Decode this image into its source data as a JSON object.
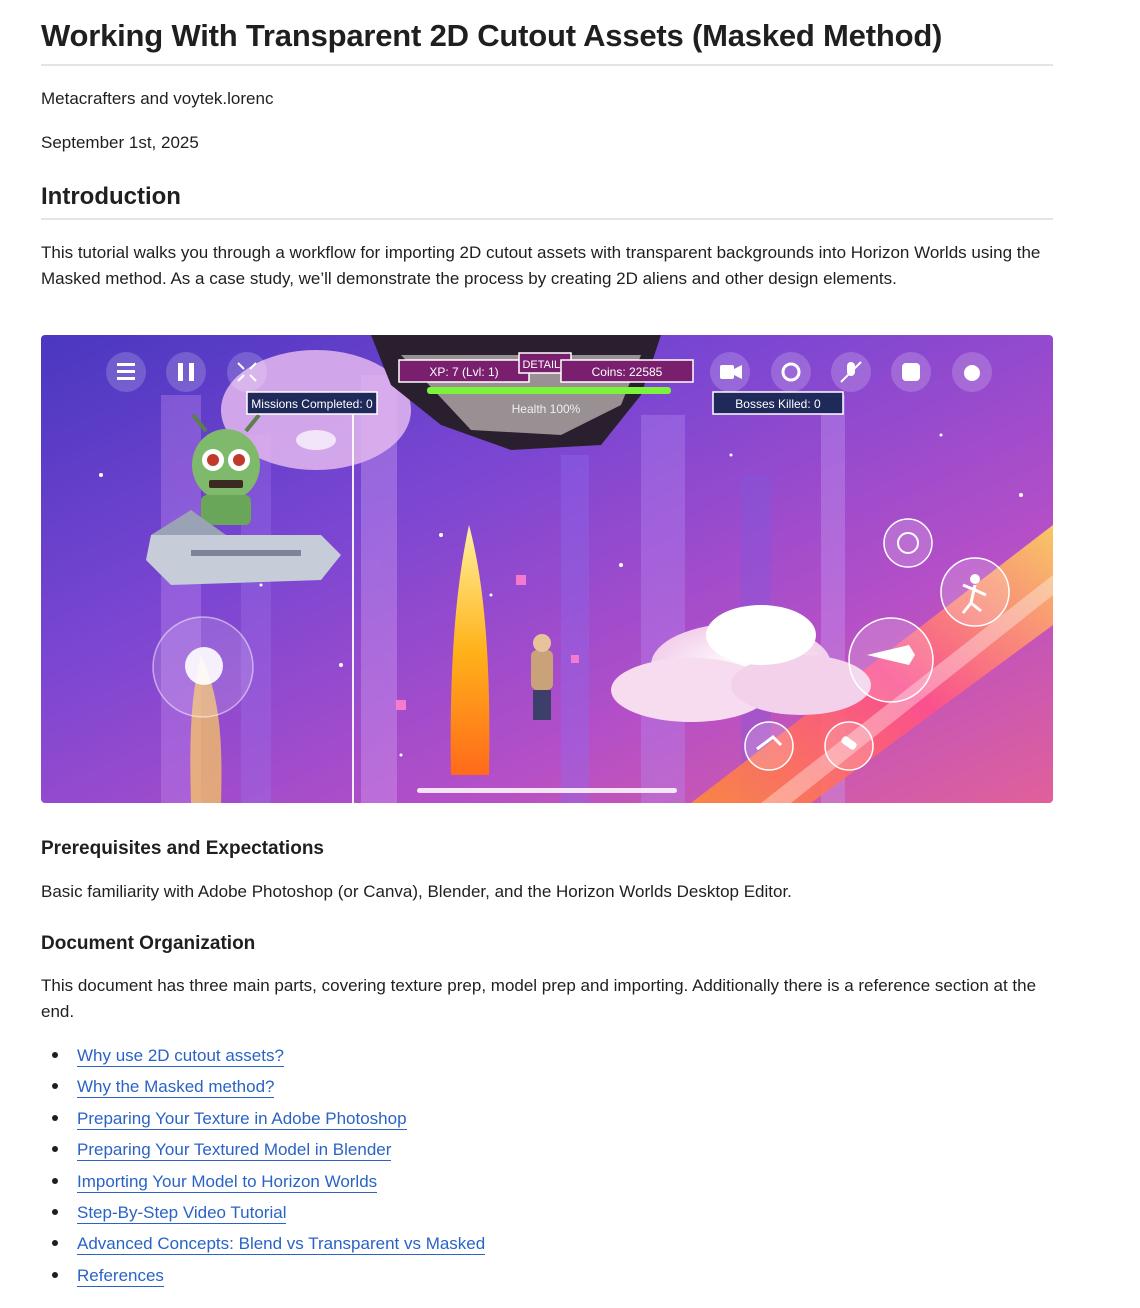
{
  "title": "Working With Transparent 2D Cutout Assets (Masked Method)",
  "authors": "Metacrafters and voytek.lorenc",
  "date": "September 1st, 2025",
  "intro": {
    "heading": "Introduction",
    "body": "This tutorial walks you through a workflow for importing 2D cutout assets with transparent backgrounds into Horizon Worlds using the Masked method. As a case study, we’ll demonstrate the process by creating 2D aliens and other design elements."
  },
  "hero": {
    "hud": {
      "xp": "XP: 7 (Lvl: 1)",
      "details": "DETAILS",
      "coins": "Coins: 22585",
      "health": "Health 100%",
      "missions": "Missions Completed: 0",
      "bosses": "Bosses Killed: 0"
    },
    "colors": {
      "sky_top": "#5a3fc9",
      "sky_mid": "#8a4fd6",
      "sky_low": "#e06aa8",
      "flame": "#ffb21a",
      "hud_fill": "#7a1f6e",
      "health_bar": "#7cf23a",
      "stripe_orange": "#ff7a3d"
    }
  },
  "prereq": {
    "heading": "Prerequisites and Expectations",
    "body": "Basic familiarity with Adobe Photoshop (or Canva), Blender, and the Horizon Worlds Desktop Editor."
  },
  "organization": {
    "heading": "Document Organization",
    "body": "This document has three main parts, covering texture prep, model prep and importing. Additionally there is a reference section at the end.",
    "links": [
      "Why use 2D cutout assets?",
      "Why the Masked method?",
      "Preparing Your Texture in Adobe Photoshop",
      "Preparing Your Textured Model in Blender",
      "Importing Your Model to Horizon Worlds",
      "Step-By-Step Video Tutorial",
      "Advanced Concepts: Blend vs Transparent vs Masked",
      "References"
    ]
  }
}
